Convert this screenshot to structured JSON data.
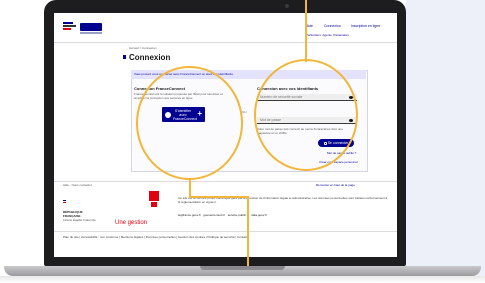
{
  "header": {
    "logo_mark": "RÉPUBLIQUE FRANÇAISE",
    "brand": "FranceConnect",
    "links": [
      "Aide",
      "Connexion",
      "Inscription en ligne"
    ],
    "nav_links": [
      "Particuliers",
      "Agents",
      "Partenaires",
      "Accessibilité",
      "Contact",
      "Mentions légales"
    ]
  },
  "breadcrumb": "Accueil > Connexion",
  "page_title": "Connexion",
  "banner": "Vous pouvez vous connecter avec FranceConnect ou avec vos identifiants",
  "left": {
    "title": "Connexion FranceConnect",
    "description": "FranceConnect est la solution proposée par l'État pour sécuriser et simplifier la connexion aux services en ligne.",
    "button": "S'identifier avec FranceConnect",
    "separator": "OU"
  },
  "right": {
    "title": "Connexion avec vos identifiants",
    "identifier_placeholder": "Numéro de sécurité sociale",
    "password_placeholder": "Mot de passe",
    "hint": "Votre mot de passe doit contenir au moins 8 caractères dont une majuscule et un chiffre",
    "connect_button": "Se connecter",
    "forgot": "Mot de passe oublié ?",
    "create": "Créer mon espace personnel"
  },
  "footer": {
    "top_left": "Aide · Nous contacter",
    "top_right": "Remonter en haut de la page",
    "rf_text": "RÉPUBLIQUE\nFRANÇAISE",
    "rf_motto": "Liberté Égalité Fraternité",
    "une_gestion": "Une gestion",
    "description": "Ce site est un service public numérique géré par la Direction de l'information légale et administrative. Les données personnelles sont traitées conformément à la réglementation en vigueur.",
    "links": [
      "legifrance.gouv.fr",
      "gouvernement.fr",
      "service-public.fr",
      "data.gouv.fr"
    ],
    "bottom_links": [
      "Plan du site",
      "Accessibilité : non conforme",
      "Mentions légales",
      "Données personnelles",
      "Gestion des cookies",
      "Politique de sécurité",
      "Contact"
    ]
  },
  "colors": {
    "accent": "#000091",
    "highlight": "#f4b63a",
    "red": "#e1000f",
    "panel": "#eef0f9"
  }
}
